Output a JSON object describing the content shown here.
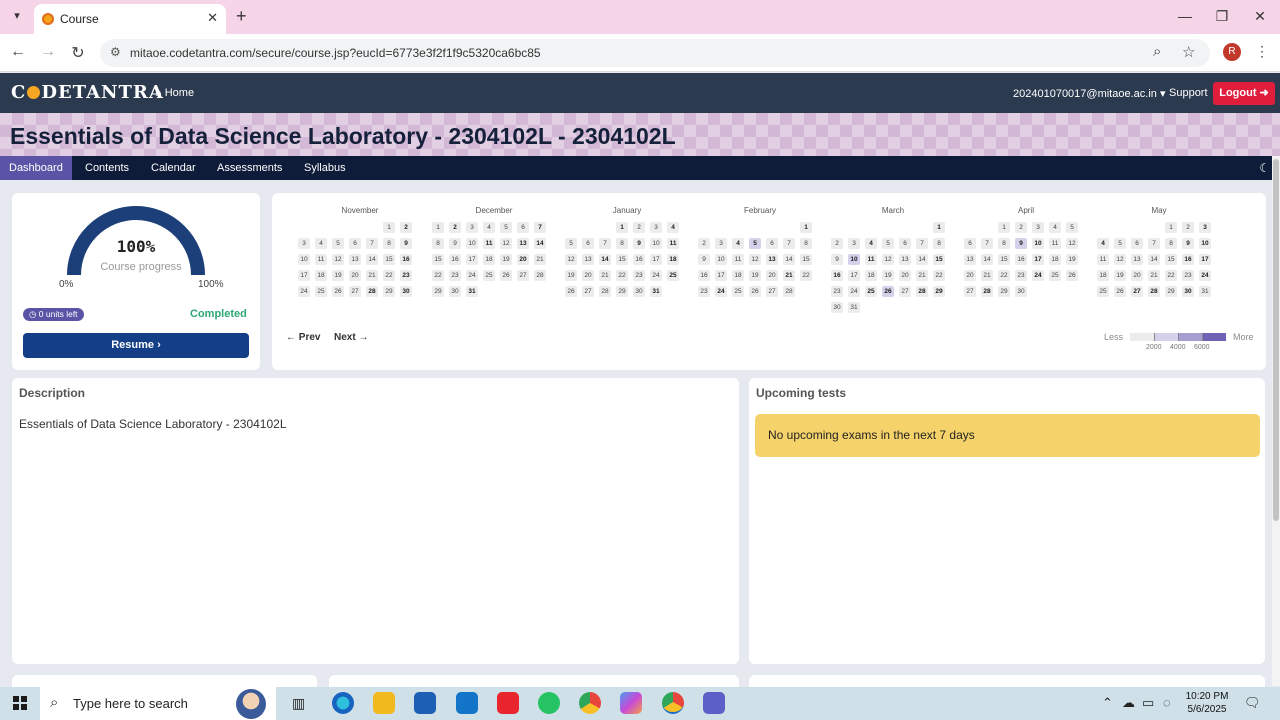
{
  "browser": {
    "tab_title": "Course",
    "url": "mitaoe.codetantra.com/secure/course.jsp?eucId=6773e3f2f1f9c5320ca6bc85",
    "profile_initial": "R"
  },
  "header": {
    "logo_text_a": "C",
    "logo_text_b": "DETANTRA",
    "home_label": "Home",
    "email": "202401070017@mitaoe.ac.in",
    "support_label": "Support",
    "logout_label": "Logout"
  },
  "course_title": "Essentials of Data Science Laboratory - 2304102L - 2304102L",
  "subnav": [
    "Dashboard",
    "Contents",
    "Calendar",
    "Assessments",
    "Syllabus"
  ],
  "progress": {
    "percent_text": "100%",
    "percent_value": 100,
    "label": "Course progress",
    "min_label": "0%",
    "max_label": "100%",
    "units_left": "0 units left",
    "status": "Completed",
    "resume_label": "Resume"
  },
  "heatmap": {
    "prev_label": "Prev",
    "next_label": "Next",
    "legend_less": "Less",
    "legend_more": "More",
    "legend_ticks": [
      "2000",
      "4000",
      "6000"
    ],
    "months": [
      {
        "name": "November",
        "days": 30,
        "offset": 5
      },
      {
        "name": "December",
        "days": 31,
        "offset": 0
      },
      {
        "name": "January",
        "days": 31,
        "offset": 3
      },
      {
        "name": "February",
        "days": 28,
        "offset": 6
      },
      {
        "name": "March",
        "days": 31,
        "offset": 6
      },
      {
        "name": "April",
        "days": 30,
        "offset": 2
      },
      {
        "name": "May",
        "days": 31,
        "offset": 4
      }
    ]
  },
  "description": {
    "heading": "Description",
    "text": "Essentials of Data Science Laboratory - 2304102L"
  },
  "upcoming": {
    "heading": "Upcoming tests",
    "notice": "No upcoming exams in the next 7 days"
  },
  "taskbar": {
    "search_placeholder": "Type here to search",
    "time": "10:20 PM",
    "date": "5/6/2025"
  }
}
